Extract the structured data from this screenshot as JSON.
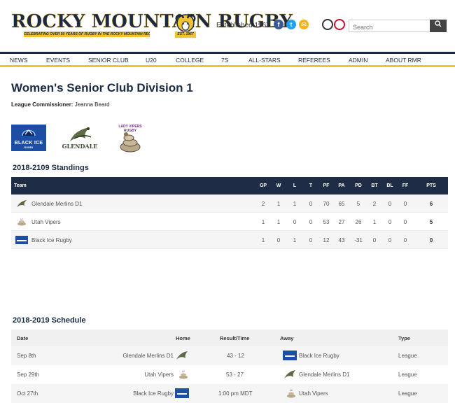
{
  "header": {
    "logo_title": "ROCKY MOUNTAIN RUGBY",
    "logo_tagline": "CELEBRATING OVER 50 YEARS OF RUGBY IN THE ROCKY MOUNTAIN REGION",
    "logo_badge": "EST. 1967",
    "established": "Established 1967",
    "search": {
      "placeholder": "Search"
    }
  },
  "nav": [
    "NEWS",
    "EVENTS",
    "SENIOR CLUB",
    "U20",
    "COLLEGE",
    "7S",
    "ALL-STARS",
    "REFEREES",
    "ADMIN",
    "ABOUT RMR"
  ],
  "page": {
    "title": "Women's Senior Club Division 1",
    "commissioner_label": "League Commissioner:",
    "commissioner_name": "Jeanna Beard"
  },
  "team_logos": {
    "blackice_text": "BLACK ICE",
    "blackice_sub": "RUGBY",
    "glendale_text": "GLENDALE",
    "vipers_text": "LADY VIPERS RUGBY"
  },
  "standings": {
    "title": "2018-2109 Standings",
    "columns": [
      "Team",
      "GP",
      "W",
      "L",
      "T",
      "PF",
      "PA",
      "PD",
      "BT",
      "BL",
      "FF",
      "PTS"
    ],
    "rows": [
      {
        "team": "Glendale Merlins D1",
        "gp": "2",
        "w": "1",
        "l": "1",
        "t": "0",
        "pf": "70",
        "pa": "65",
        "pd": "5",
        "bt": "2",
        "bl": "0",
        "ff": "0",
        "pts": "6"
      },
      {
        "team": "Utah Vipers",
        "gp": "1",
        "w": "1",
        "l": "0",
        "t": "0",
        "pf": "53",
        "pa": "27",
        "pd": "26",
        "bt": "1",
        "bl": "0",
        "ff": "0",
        "pts": "5"
      },
      {
        "team": "Black Ice Rugby",
        "gp": "1",
        "w": "0",
        "l": "1",
        "t": "0",
        "pf": "12",
        "pa": "43",
        "pd": "-31",
        "bt": "0",
        "bl": "0",
        "ff": "0",
        "pts": "0"
      }
    ]
  },
  "schedule": {
    "title": "2018-2019 Schedule",
    "columns": [
      "Date",
      "Home",
      "Result/Time",
      "Away",
      "Type"
    ],
    "rows": [
      {
        "date": "Sep 8th",
        "home": "Glendale Merlins D1",
        "result": "43 - 12",
        "away": "Black Ice Rugby",
        "type": "League"
      },
      {
        "date": "Sep 29th",
        "home": "Utah Vipers",
        "result": "53 - 27",
        "away": "Glendale Merlins D1",
        "type": "League"
      },
      {
        "date": "Oct 27th",
        "home": "Black Ice Rugby",
        "result": "1:00 pm MDT",
        "away": "Utah Vipers",
        "type": "League"
      }
    ]
  },
  "colors": {
    "navy": "#1b2a44",
    "gold": "#f2c230",
    "table_header": "#1e2d45",
    "facebook": "#3b5998",
    "twitter": "#1da1f2",
    "email": "#f5b31b"
  }
}
